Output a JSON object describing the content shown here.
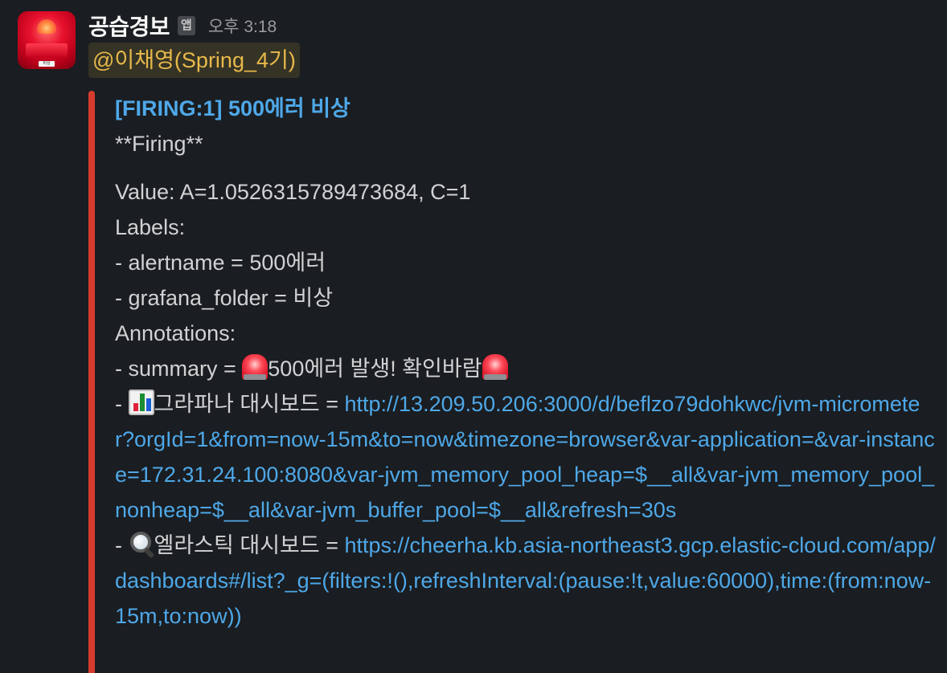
{
  "message": {
    "sender": "공습경보",
    "app_badge": "앱",
    "timestamp": "오후 3:18",
    "mention": "@이채영(Spring_4기)"
  },
  "attachment": {
    "color": "#d63b2f",
    "title": "[FIRING:1] 500에러 비상",
    "status_line": "**Firing**",
    "value_line": "Value: A=1.0526315789473684, C=1",
    "labels_heading": "Labels:",
    "labels": [
      "- alertname = 500에러",
      "- grafana_folder = 비상"
    ],
    "annotations_heading": "Annotations:",
    "summary_prefix": "- summary = ",
    "summary_text": "500에러 발생! 확인바람",
    "grafana_prefix": "- ",
    "grafana_label": "그라파나 대시보드 = ",
    "grafana_url": "http://13.209.50.206:3000/d/beflzo79dohkwc/jvm-micrometer?orgId=1&from=now-15m&to=now&timezone=browser&var-application=&var-instance=172.31.24.100:8080&var-jvm_memory_pool_heap=$__all&var-jvm_memory_pool_nonheap=$__all&var-jvm_buffer_pool=$__all&refresh=30s",
    "elastic_prefix": "- ",
    "elastic_label": "엘라스틱 대시보드 = ",
    "elastic_url": "https://cheerha.kb.asia-northeast3.gcp.elastic-cloud.com/app/dashboards#/list?_g=(filters:!(),refreshInterval:(pause:!t,value:60000),time:(from:now-15m,to:now))"
  },
  "icons": {
    "avatar": "siren-avatar",
    "summary_emoji": "rotating-light-icon",
    "grafana_emoji": "bar-chart-icon",
    "elastic_emoji": "magnifying-glass-icon"
  }
}
